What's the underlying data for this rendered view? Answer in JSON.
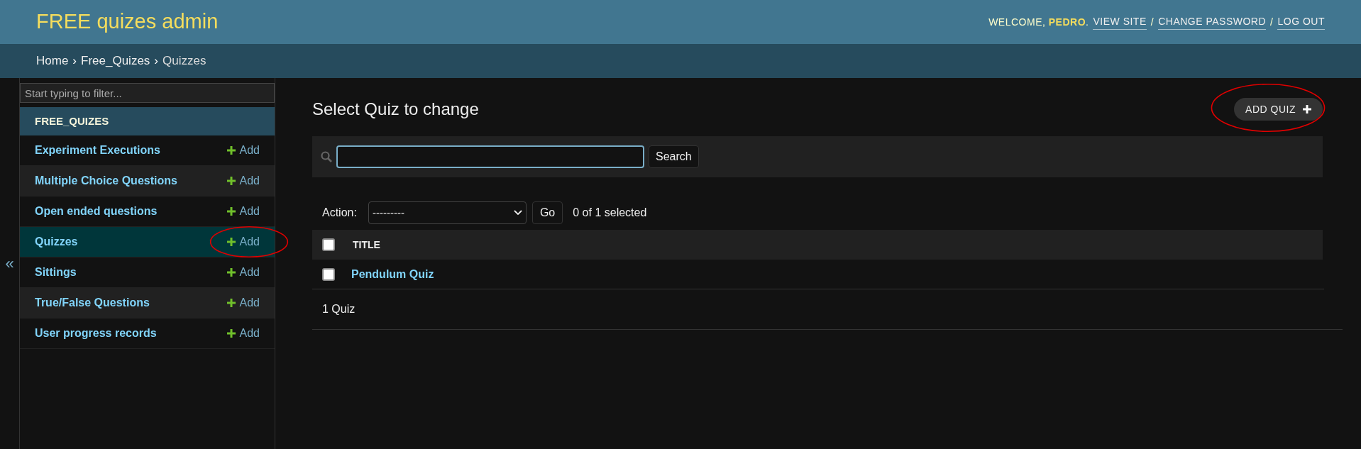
{
  "header": {
    "title": "FREE quizes admin",
    "welcome": "WELCOME, **PEDRO**.",
    "links": [
      "VIEW SITE",
      "CHANGE PASSWORD",
      "LOG OUT"
    ],
    "separator": "/"
  },
  "breadcrumbs": [
    "Home",
    "Free_Quizes",
    "Quizzes"
  ],
  "breadcrumb_separator": "›",
  "sidebar": {
    "filter_placeholder": "Start typing to filter...",
    "app": "FREE_QUIZES",
    "collapse": "«",
    "models": [
      {
        "name": "Experiment Executions",
        "add": "Add",
        "selected": false,
        "circled": false
      },
      {
        "name": "Multiple Choice Questions",
        "add": "Add",
        "selected": false,
        "circled": false
      },
      {
        "name": "Open ended questions",
        "add": "Add",
        "selected": false,
        "circled": false
      },
      {
        "name": "Quizzes",
        "add": "Add",
        "selected": true,
        "circled": true
      },
      {
        "name": "Sittings",
        "add": "Add",
        "selected": false,
        "circled": false
      },
      {
        "name": "True/False Questions",
        "add": "Add",
        "selected": false,
        "circled": false
      },
      {
        "name": "User progress records",
        "add": "Add",
        "selected": false,
        "circled": false
      }
    ]
  },
  "content": {
    "title": "Select Quiz to change",
    "add_button": "ADD QUIZ",
    "add_circled": true,
    "search_button": "Search",
    "action_label": "Action:",
    "action_value": "---------",
    "go_button": "Go",
    "selection_count": "0 of 1 selected",
    "columns": [
      "TITLE"
    ],
    "select_all_checked": false,
    "rows": [
      {
        "title": "Pendulum Quiz",
        "checked": false
      }
    ],
    "result_count": "1 Quiz"
  }
}
